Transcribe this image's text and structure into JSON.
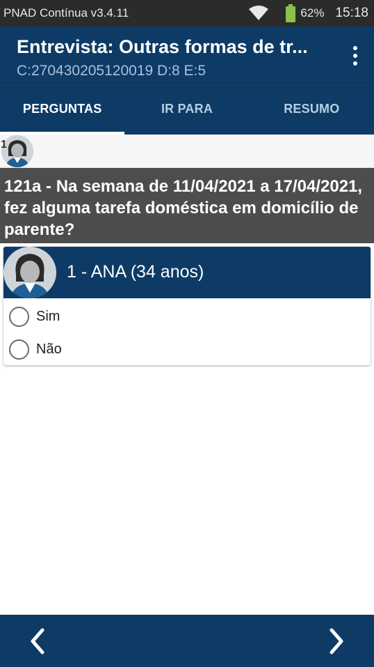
{
  "status_bar": {
    "app_name": "PNAD Contínua v3.4.11",
    "battery_percent": "62%",
    "time": "15:18",
    "icons": [
      "wifi-icon",
      "battery-icon"
    ]
  },
  "app_bar": {
    "title": "Entrevista: Outras formas de tr...",
    "subtitle": "C:270430205120019 D:8 E:5",
    "menu_icon": "more-vert-icon"
  },
  "tabs": [
    {
      "label": "PERGUNTAS",
      "active": true
    },
    {
      "label": "IR PARA",
      "active": false
    },
    {
      "label": "RESUMO",
      "active": false
    }
  ],
  "person_strip": {
    "person_number": "1"
  },
  "question": {
    "text": "121a - Na semana de 11/04/2021 a 17/04/2021, fez alguma tarefa doméstica em domicílio de parente?"
  },
  "answer_card": {
    "person_label": "1 - ANA (34 anos)",
    "options": [
      {
        "label": "Sim",
        "selected": false
      },
      {
        "label": "Não",
        "selected": false
      }
    ]
  },
  "bottom_bar": {
    "prev_icon": "chevron-left-icon",
    "next_icon": "chevron-right-icon"
  },
  "colors": {
    "primary": "#0d3b66",
    "question_bg": "#4d4d4d",
    "status_bar": "#2b2b2b",
    "battery": "#8bc34a"
  }
}
